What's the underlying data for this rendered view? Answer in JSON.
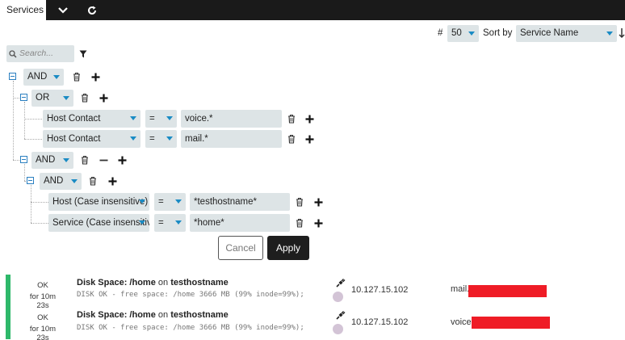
{
  "topbar": {
    "tab_label": "Services",
    "icons": [
      "chevron-down-icon",
      "refresh-icon"
    ]
  },
  "controls": {
    "count_label": "#",
    "count_value": "50",
    "sortby_label": "Sort by",
    "sortby_value": "Service Name"
  },
  "search": {
    "placeholder": "Search..."
  },
  "filter": {
    "root_op": "AND",
    "group1": {
      "op": "OR",
      "rules": [
        {
          "field": "Host Contact",
          "operator": "=",
          "value": "voice.*"
        },
        {
          "field": "Host Contact",
          "operator": "=",
          "value": "mail.*"
        }
      ]
    },
    "group2": {
      "op": "AND",
      "subgroup": {
        "op": "AND",
        "rules": [
          {
            "field": "Host (Case insensitive)",
            "operator": "=",
            "value": "*testhostname*"
          },
          {
            "field": "Service (Case insensitive)",
            "operator": "=",
            "value": "*home*"
          }
        ]
      }
    }
  },
  "buttons": {
    "cancel": "Cancel",
    "apply": "Apply"
  },
  "results": [
    {
      "state": "OK",
      "duration": "for 10m 23s",
      "service": "Disk Space: /home",
      "on": "on",
      "host": "testhostname",
      "output": "DISK OK - free space: /home 3666 MB (99% inode=99%);",
      "ip": "10.127.15.102",
      "contact": "mail."
    },
    {
      "state": "OK",
      "duration": "for 10m 23s",
      "service": "Disk Space: /home",
      "on": "on",
      "host": "testhostname",
      "output": "DISK OK - free space: /home 3666 MB (99% inode=99%);",
      "ip": "10.127.15.102",
      "contact": "voice."
    }
  ],
  "colors": {
    "ok": "#2eb86a",
    "accent": "#1a8bc4",
    "redaction": "#ef1c26"
  }
}
